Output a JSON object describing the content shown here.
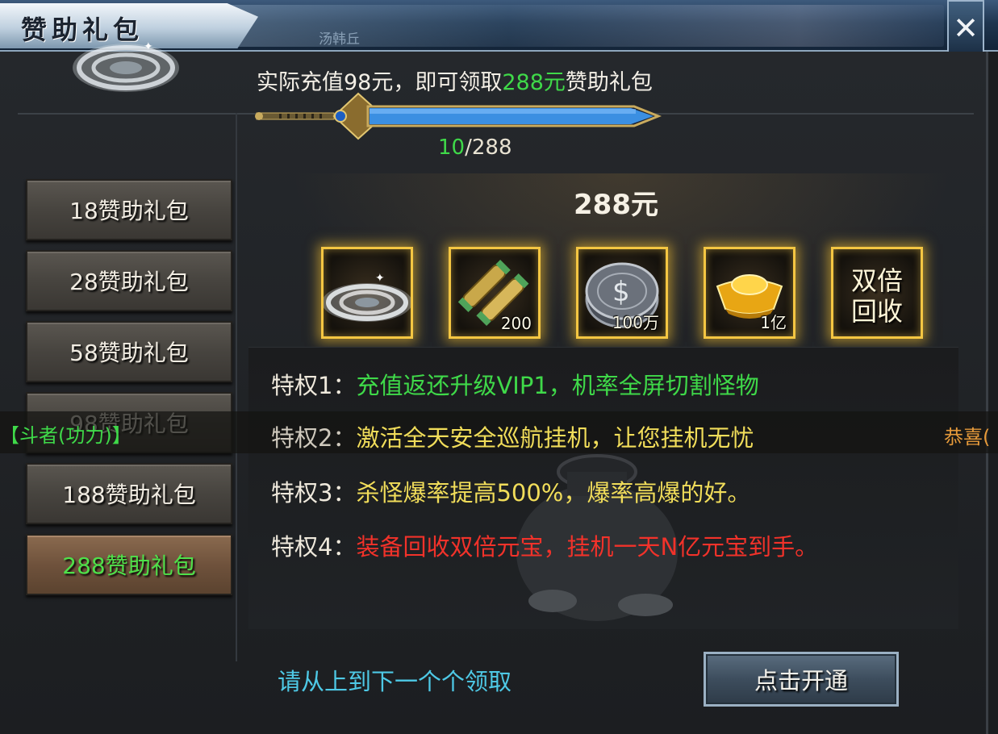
{
  "window": {
    "title": "赞助礼包",
    "background_text": "汤韩丘",
    "close_label": "✕"
  },
  "progress": {
    "prefix": "实际充值98元，即可领取",
    "highlight": "288元",
    "suffix": "赞助礼包",
    "current": "10",
    "total": "/288",
    "fraction": 0.035
  },
  "tiers": [
    {
      "label": "18赞助礼包",
      "active": false
    },
    {
      "label": "28赞助礼包",
      "active": false
    },
    {
      "label": "58赞助礼包",
      "active": false
    },
    {
      "label": "98赞助礼包",
      "active": false
    },
    {
      "label": "188赞助礼包",
      "active": false
    },
    {
      "label": "288赞助礼包",
      "active": true
    }
  ],
  "rewards": {
    "price": "288元",
    "items": [
      {
        "icon": "silver-disc-icon",
        "qty": ""
      },
      {
        "icon": "scroll-icon",
        "qty": "200"
      },
      {
        "icon": "coin-icon",
        "qty": "100万"
      },
      {
        "icon": "gold-ingot-icon",
        "qty": "1亿"
      },
      {
        "icon": "double-recycle-text",
        "qty": "",
        "text_line1": "双倍",
        "text_line2": "回收"
      }
    ]
  },
  "privileges": [
    {
      "label": "特权1：",
      "desc": "充值返还升级VIP1，机率全屏切割怪物",
      "color": "#3fd949"
    },
    {
      "label": "特权2：",
      "desc": "激活全天安全巡航挂机，让您挂机无忧",
      "color": "#f1dd5a"
    },
    {
      "label": "特权3：",
      "desc": "杀怪爆率提高500%，爆率高爆的好。",
      "color": "#f1dd5a"
    },
    {
      "label": "特权4：",
      "desc": "装备回收双倍元宝，挂机一天N亿元宝到手。",
      "color": "#f2322a"
    }
  ],
  "chat": {
    "left": "【斗者(功力)】",
    "right": "恭喜("
  },
  "footer": {
    "hint": "请从上到下一个个领取",
    "open_button": "点击开通"
  }
}
